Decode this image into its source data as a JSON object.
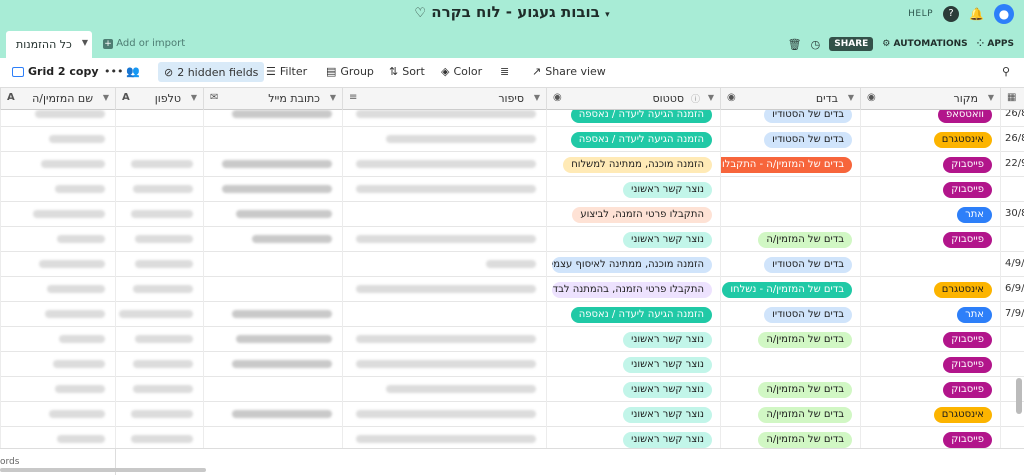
{
  "topbar": {
    "title": "בובות געגוע - לוח בקרה",
    "help_label": "HELP",
    "help_icon": "?",
    "avatar_icon": "person-icon"
  },
  "tabbar": {
    "view_tab_label": "כל ההזמנות",
    "add_import_label": "Add or import",
    "share_label": "SHARE",
    "automations_label": "AUTOMATIONS",
    "apps_label": "APPS"
  },
  "toolbar": {
    "view_name": "Grid 2 copy",
    "hidden_fields": "2 hidden fields",
    "filter": "Filter",
    "group": "Group",
    "sort": "Sort",
    "color": "Color",
    "share_view": "Share view"
  },
  "columns": {
    "name": "שם המזמין/ה",
    "phone": "טלפון",
    "email": "כתובת מייל",
    "story": "סיפור",
    "status": "סטטוס",
    "fabric": "בדים",
    "source": "מקור"
  },
  "rows": [
    {
      "status": "הזמנה הגיעה ליעדה / נאספה",
      "status_color": "teal",
      "fabric": "בדים של הסטודיו",
      "fabric_color": "blue",
      "source": "וואטסאפ",
      "source_color": "magenta",
      "date": "26/8"
    },
    {
      "status": "הזמנה הגיעה ליעדה / נאספה",
      "status_color": "teal",
      "fabric": "בדים של הסטודיו",
      "fabric_color": "blue",
      "source": "אינסטגרם",
      "source_color": "gold",
      "date": "26/8"
    },
    {
      "status": "הזמנה מוכנה, ממתינה למשלוח",
      "status_color": "yellow",
      "fabric": "בדים של המזמין/ה - התקבלו",
      "fabric_color": "orange-dark",
      "source": "פייסבוק",
      "source_color": "magenta",
      "date": "22/9"
    },
    {
      "status": "נוצר קשר ראשוני",
      "status_color": "cyan",
      "fabric": "",
      "fabric_color": "",
      "source": "פייסבוק",
      "source_color": "magenta",
      "date": ""
    },
    {
      "status": "התקבלו פרטי הזמנה, לביצוע",
      "status_color": "orange",
      "fabric": "",
      "fabric_color": "",
      "source": "אתר",
      "source_color": "royal",
      "date": "30/8"
    },
    {
      "status": "נוצר קשר ראשוני",
      "status_color": "cyan",
      "fabric": "בדים של המזמין/ה",
      "fabric_color": "green",
      "source": "פייסבוק",
      "source_color": "magenta",
      "date": ""
    },
    {
      "status": "הזמנה מוכנה, ממתינה לאיסוף עצמי",
      "status_color": "blue",
      "fabric": "בדים של הסטודיו",
      "fabric_color": "blue",
      "source": "",
      "source_color": "",
      "date": "4/9/"
    },
    {
      "status": "התקבלו פרטי הזמנה, בהמתנה לבדים",
      "status_color": "lav",
      "fabric": "בדים של המזמין/ה - נשלחו",
      "fabric_color": "teal2",
      "source": "אינסטגרם",
      "source_color": "gold",
      "date": "6/9/"
    },
    {
      "status": "הזמנה הגיעה ליעדה / נאספה",
      "status_color": "teal",
      "fabric": "בדים של הסטודיו",
      "fabric_color": "blue",
      "source": "אתר",
      "source_color": "royal",
      "date": "7/9/"
    },
    {
      "status": "נוצר קשר ראשוני",
      "status_color": "cyan",
      "fabric": "בדים של המזמין/ה",
      "fabric_color": "green",
      "source": "פייסבוק",
      "source_color": "magenta",
      "date": ""
    },
    {
      "status": "נוצר קשר ראשוני",
      "status_color": "cyan",
      "fabric": "",
      "fabric_color": "",
      "source": "פייסבוק",
      "source_color": "magenta",
      "date": ""
    },
    {
      "status": "נוצר קשר ראשוני",
      "status_color": "cyan",
      "fabric": "בדים של המזמין/ה",
      "fabric_color": "green",
      "source": "פייסבוק",
      "source_color": "magenta",
      "date": ""
    },
    {
      "status": "נוצר קשר ראשוני",
      "status_color": "cyan",
      "fabric": "בדים של המזמין/ה",
      "fabric_color": "green",
      "source": "אינסטגרם",
      "source_color": "gold",
      "date": ""
    },
    {
      "status": "נוצר קשר ראשוני",
      "status_color": "cyan",
      "fabric": "בדים של המזמין/ה",
      "fabric_color": "green",
      "source": "פייסבוק",
      "source_color": "magenta",
      "date": ""
    }
  ],
  "footer": {
    "records_label": "ords"
  }
}
